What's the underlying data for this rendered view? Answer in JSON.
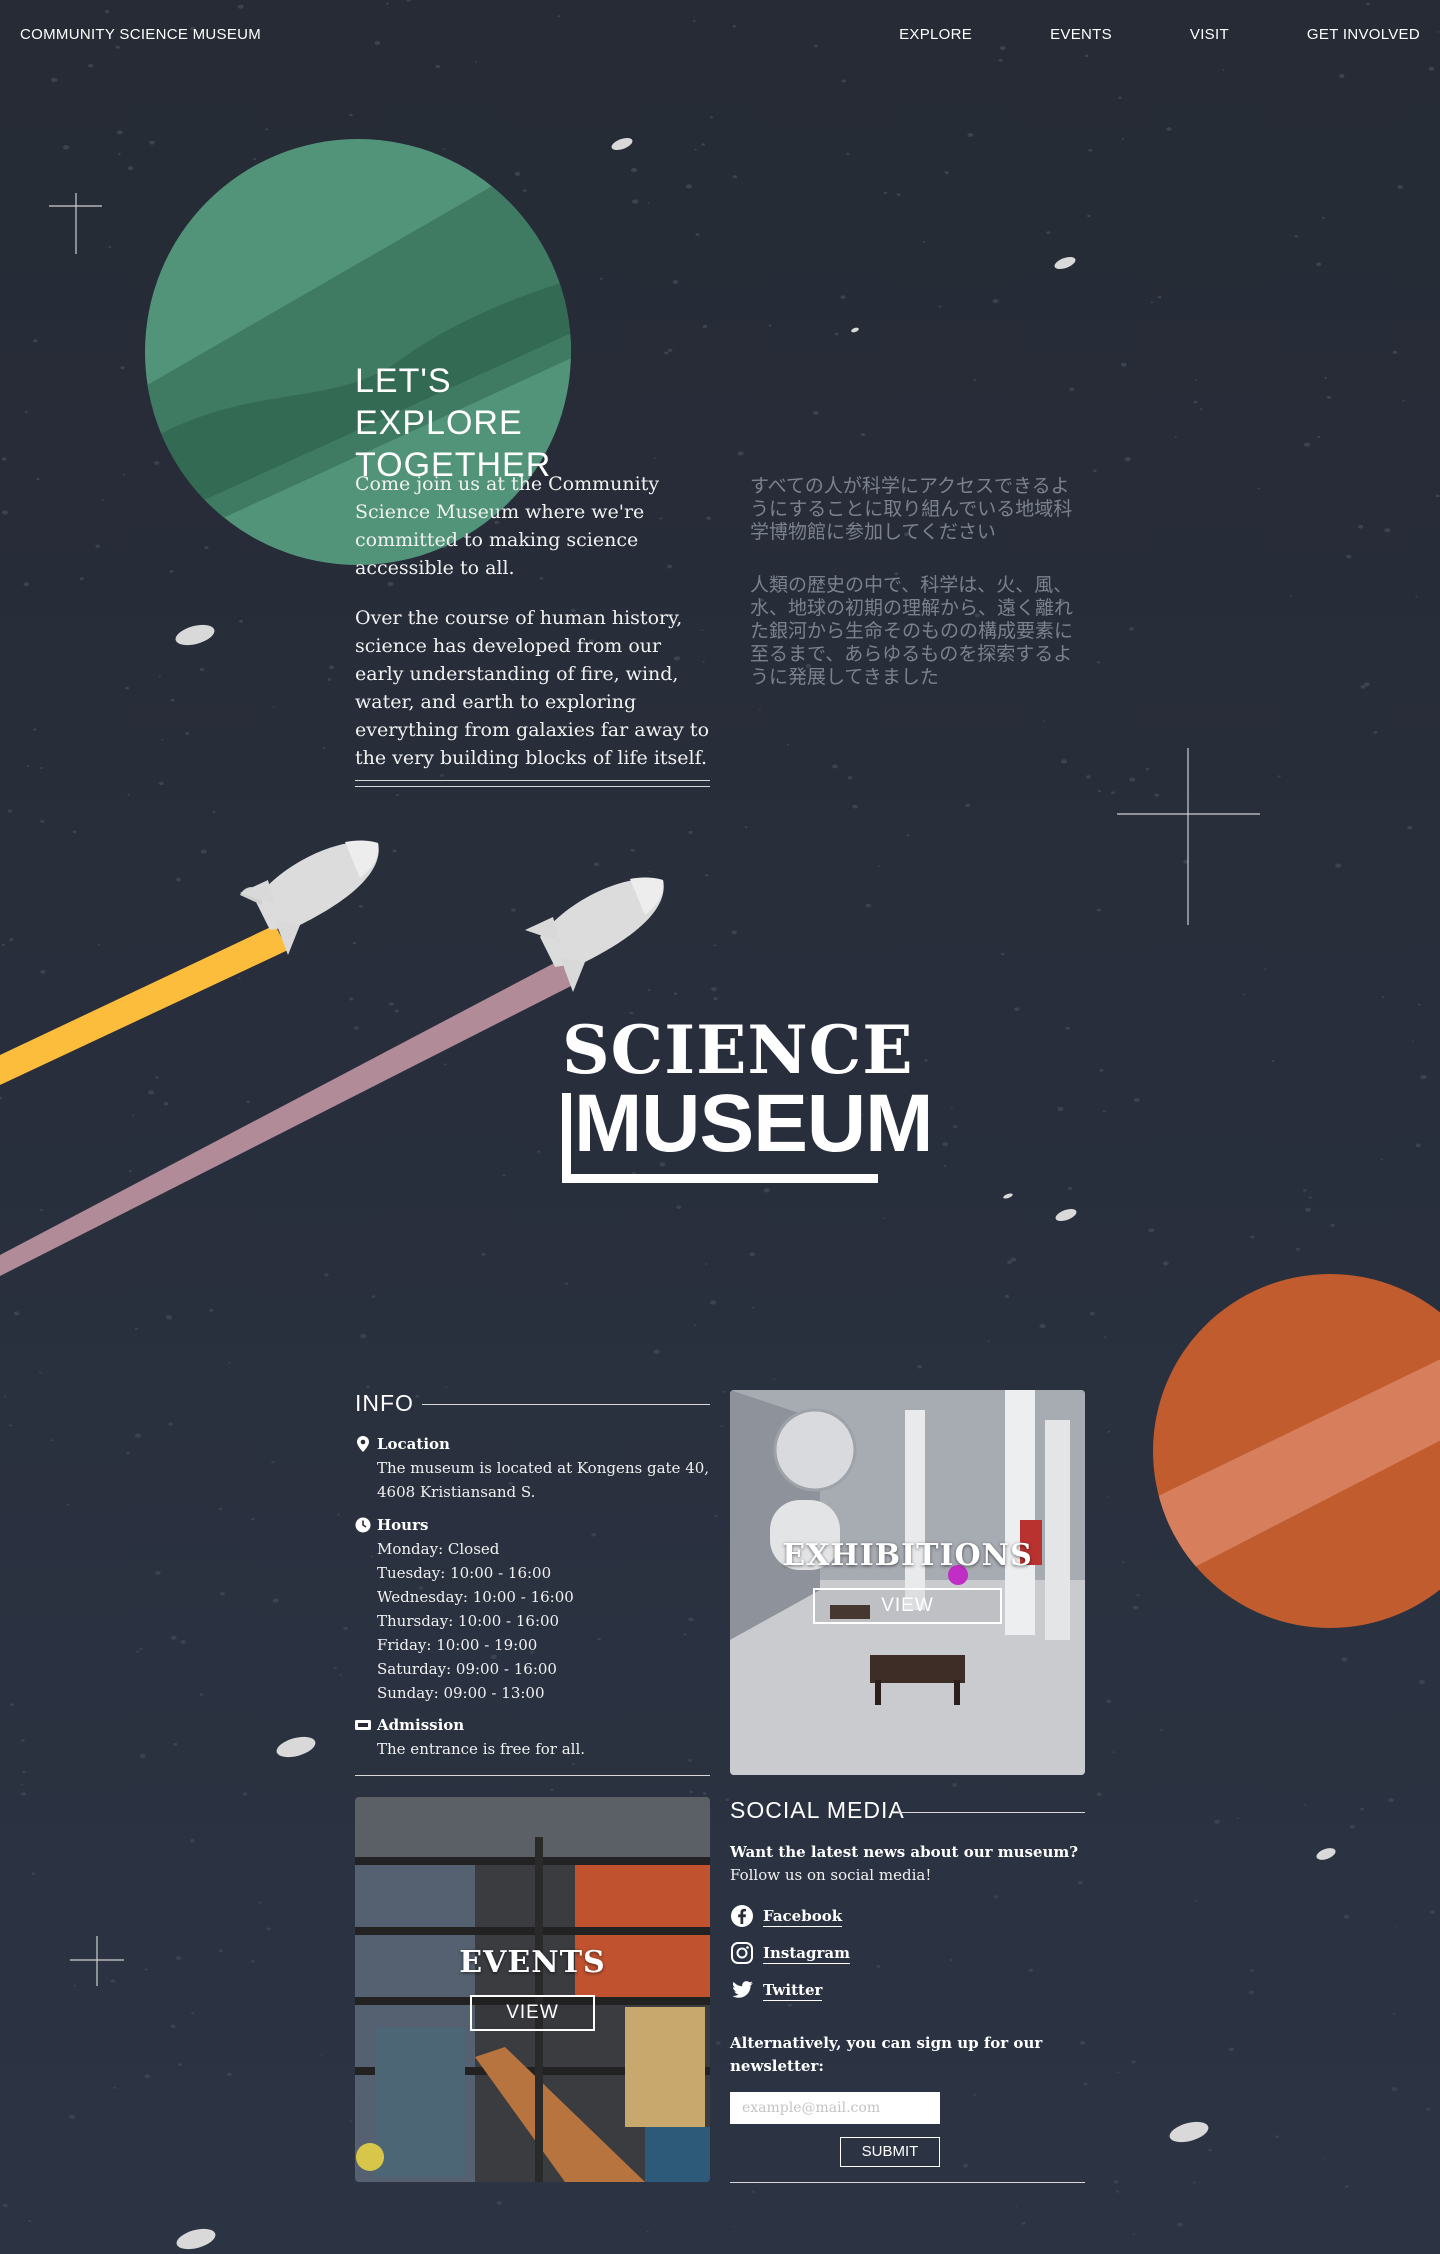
{
  "nav": {
    "brand": "COMMUNITY SCIENCE MUSEUM",
    "links": [
      "EXPLORE",
      "EVENTS",
      "VISIT",
      "GET INVOLVED"
    ]
  },
  "hero": {
    "title_line1": "LET'S EXPLORE",
    "title_line2": "TOGETHER",
    "paragraphs": [
      "Come join us at the Community Science Museum where we're committed to making science accessible to all.",
      "Over the course of human history, science has developed from our early understanding of fire, wind, water, and earth to exploring everything from galaxies far away to the very building blocks of life itself."
    ],
    "paragraphs_ja": [
      "すべての人が科学にアクセスできるようにすることに取り組んでいる地域科学博物館に参加してください",
      "人類の歴史の中で、科学は、火、風、水、地球の初期の理解から、遠く離れた銀河から生命そのものの構成要素に至るまで、あらゆるものを探索するように発展してきました"
    ]
  },
  "logo": {
    "line1": "SCIENCE",
    "line2": "MUSEUM"
  },
  "info": {
    "heading": "INFO",
    "location_label": "Location",
    "location_text": "The museum is located at Kongens gate 40, 4608 Kristiansand S.",
    "hours_label": "Hours",
    "hours": [
      "Monday: Closed",
      "Tuesday: 10:00 - 16:00",
      "Wednesday: 10:00 - 16:00",
      "Thursday: 10:00 - 16:00",
      "Friday: 10:00 - 19:00",
      "Saturday: 09:00 - 16:00",
      "Sunday: 09:00 - 13:00"
    ],
    "admission_label": "Admission",
    "admission_text": "The entrance is free for all."
  },
  "cards": {
    "exhibitions_title": "EXHIBITIONS",
    "exhibitions_button": "VIEW",
    "events_title": "EVENTS",
    "events_button": "VIEW"
  },
  "social": {
    "heading": "SOCIAL MEDIA",
    "intro_bold": "Want the latest news about our museum?",
    "intro": "Follow us on social media!",
    "links": [
      "Facebook",
      "Instagram",
      "Twitter"
    ],
    "newsletter_text": "Alternatively, you can sign up for our newsletter:",
    "email_placeholder": "example@mail.com",
    "submit_label": "SUBMIT"
  },
  "colors": {
    "background": "#262b35",
    "green_planet": "#4e8c76",
    "orange_planet": "#bf5a2c",
    "yellow_trail": "#fbbd3b",
    "pink_trail": "#b28b98"
  }
}
